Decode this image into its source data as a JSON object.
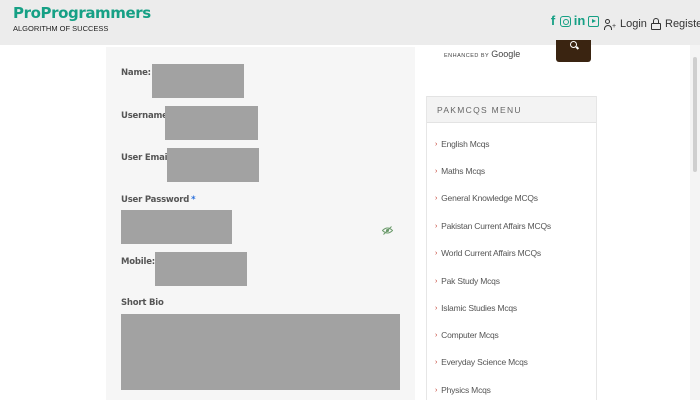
{
  "header": {
    "brand_name": "ProProgrammers",
    "brand_tagline": "ALGORITHM OF SUCCESS",
    "social_icons": [
      "facebook-icon",
      "instagram-icon",
      "linkedin-icon",
      "youtube-icon"
    ],
    "social_glyphs": {
      "facebook": "f",
      "linkedin": "in"
    },
    "login_label": "Login",
    "register_label": "Register"
  },
  "form": {
    "name_label": "Name:",
    "username_label": "Username",
    "email_label": "User Email",
    "password_label": "User Password",
    "mobile_label": "Mobile:",
    "bio_label": "Short Bio",
    "required_mark": "*",
    "field_color": "#a2a2a2"
  },
  "sidebar": {
    "search_enhanced_label": "ENHANCED BY",
    "search_google_label": "Google",
    "menu_title": "PAKMCQS MENU",
    "menu_items": [
      "English Mcqs",
      "Maths Mcqs",
      "General Knowledge MCQs",
      "Pakistan Current Affairs MCQs",
      "World Current Affairs MCQs",
      "Pak Study Mcqs",
      "Islamic Studies Mcqs",
      "Computer Mcqs",
      "Everyday Science Mcqs",
      "Physics Mcqs"
    ]
  },
  "colors": {
    "brand": "#16a085",
    "required": "#2a6fdb",
    "search_button": "#3a2411",
    "menu_caret": "#c0392b"
  }
}
